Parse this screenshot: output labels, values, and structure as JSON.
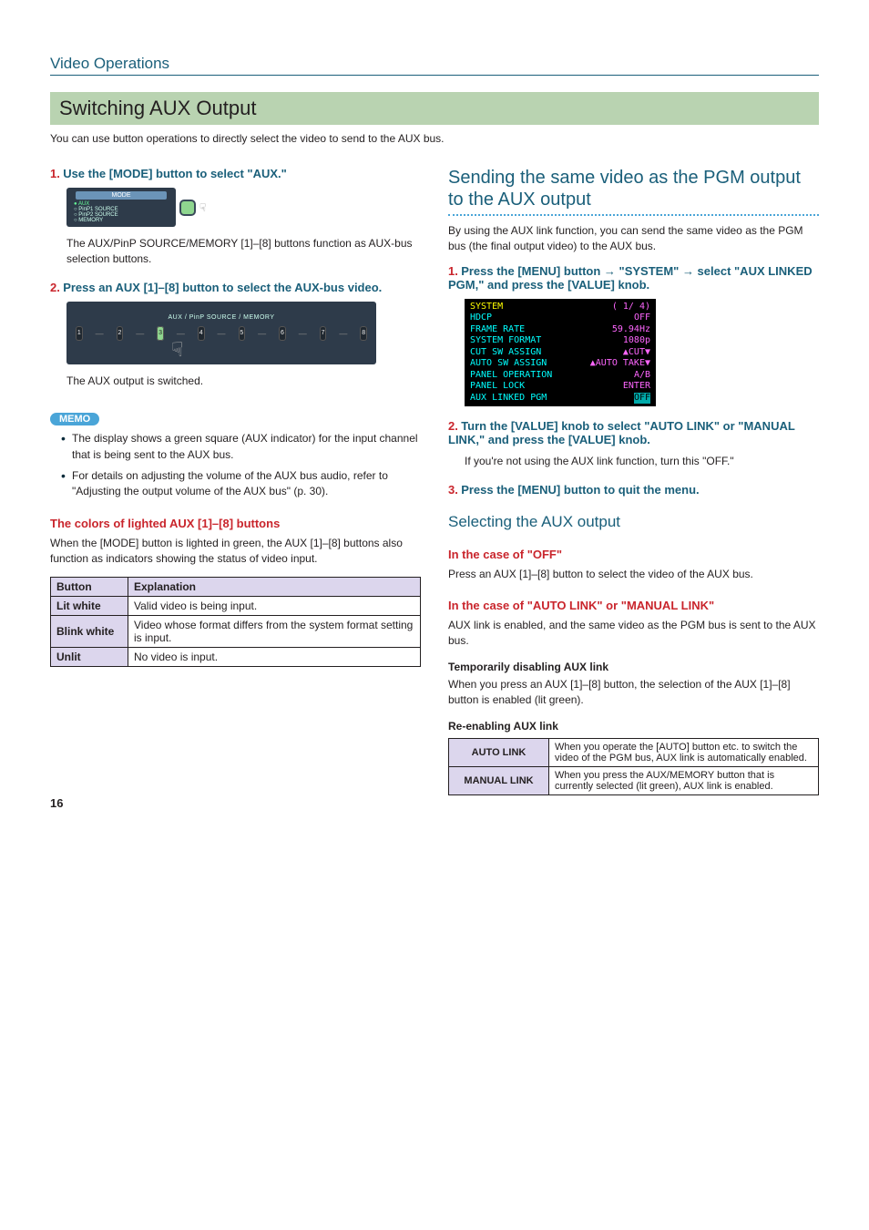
{
  "page_number": "16",
  "section_header": "Video Operations",
  "main_title": "Switching AUX Output",
  "intro": "You can use button operations to directly select the video to send to the AUX bus.",
  "left": {
    "step1": {
      "num": "1.",
      "text": "Use the [MODE] button to select \"AUX.\""
    },
    "mode": {
      "label": "MODE",
      "items": [
        "AUX",
        "PinP1 SOURCE",
        "PinP2 SOURCE",
        "MEMORY"
      ]
    },
    "step1_body": "The AUX/PinP SOURCE/MEMORY [1]–[8] buttons function as AUX-bus selection buttons.",
    "step2": {
      "num": "2.",
      "text": "Press an AUX [1]–[8] button to select the AUX-bus video."
    },
    "aux_caption": "AUX / PinP SOURCE / MEMORY",
    "aux_btns": [
      "1",
      "2",
      "3",
      "4",
      "5",
      "6",
      "7",
      "8"
    ],
    "step2_body": "The AUX output is switched.",
    "memo_label": "MEMO",
    "memo_items": [
      "The display shows a green square (AUX indicator) for the input channel that is being sent to the AUX bus.",
      "For details on adjusting the volume of the AUX bus audio, refer to \"Adjusting the output volume of the AUX bus\" (p. 30)."
    ],
    "colors_heading": "The colors of lighted AUX [1]–[8] buttons",
    "colors_body": "When the [MODE] button is lighted in green, the AUX [1]–[8] buttons also function as indicators showing the status of video input.",
    "table": {
      "head": [
        "Button",
        "Explanation"
      ],
      "rows": [
        [
          "Lit white",
          "Valid video is being input."
        ],
        [
          "Blink white",
          "Video whose format differs from the system format setting is input."
        ],
        [
          "Unlit",
          "No video is input."
        ]
      ]
    }
  },
  "right": {
    "heading": "Sending the same video as the PGM output to the AUX output",
    "body": "By using the AUX link function, you can send the same video as the PGM bus (the final output video) to the AUX bus.",
    "step1": {
      "num": "1.",
      "pre": "Press the [MENU] button ",
      "arrow1": "0",
      "mid": " \"SYSTEM\" ",
      "arrow2": "0",
      "post": " select \"AUX LINKED PGM,\" and press the [VALUE] knob."
    },
    "menu": {
      "title": "SYSTEM",
      "page": "( 1/ 4)",
      "rows": [
        {
          "k": "HDCP",
          "v": "OFF"
        },
        {
          "k": "FRAME RATE",
          "v": "59.94Hz"
        },
        {
          "k": "SYSTEM FORMAT",
          "v": "1080p"
        },
        {
          "k": "CUT SW ASSIGN",
          "v": "▲CUT▼"
        },
        {
          "k": "AUTO SW ASSIGN",
          "v": "▲AUTO TAKE▼"
        },
        {
          "k": "PANEL OPERATION",
          "v": "A/B"
        },
        {
          "k": "PANEL LOCK",
          "v": "ENTER"
        },
        {
          "k": "AUX LINKED PGM",
          "v": "OFF",
          "sel": true
        }
      ]
    },
    "step2": {
      "num": "2.",
      "text": "Turn the [VALUE] knob to select \"AUTO LINK\" or \"MANUAL LINK,\" and press the [VALUE] knob."
    },
    "step2_body": "If you're not using the AUX link function, turn this \"OFF.\"",
    "step3": {
      "num": "3.",
      "text": "Press the [MENU] button to quit the menu."
    },
    "sel_heading": "Selecting the AUX output",
    "off_head": "In the case of \"OFF\"",
    "off_body": "Press an AUX [1]–[8] button to select the video of the AUX bus.",
    "auto_head": "In the case of \"AUTO LINK\" or \"MANUAL LINK\"",
    "auto_body": "AUX link is enabled, and the same video as the PGM bus is sent to the AUX bus.",
    "temp_head": "Temporarily disabling AUX link",
    "temp_body": "When you press an AUX [1]–[8] button, the selection of the AUX [1]–[8] button is enabled (lit green).",
    "re_head": "Re-enabling AUX link",
    "link_table": [
      [
        "AUTO LINK",
        "When you operate the [AUTO] button etc. to switch the video of the PGM bus, AUX link is automatically enabled."
      ],
      [
        "MANUAL LINK",
        "When you press the AUX/MEMORY button that is currently selected (lit green), AUX link is enabled."
      ]
    ]
  }
}
